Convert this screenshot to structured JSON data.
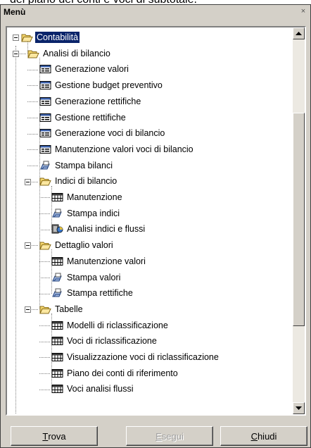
{
  "background_text": "del piano dei conti e voci di subtotale.",
  "window": {
    "title": "Menù",
    "close_glyph": "×"
  },
  "tree": {
    "items": [
      {
        "label": "Contabilità",
        "icon": "folder-open-icon",
        "level": 0,
        "expanded": true,
        "selected": true
      },
      {
        "label": "Analisi di bilancio",
        "icon": "folder-open-icon",
        "level": 1,
        "expanded": true
      },
      {
        "label": "Generazione valori",
        "icon": "form-icon",
        "level": 2
      },
      {
        "label": "Gestione budget preventivo",
        "icon": "form-icon",
        "level": 2
      },
      {
        "label": "Generazione rettifiche",
        "icon": "form-icon",
        "level": 2
      },
      {
        "label": "Gestione rettifiche",
        "icon": "form-icon",
        "level": 2
      },
      {
        "label": "Generazione voci di bilancio",
        "icon": "form-icon",
        "level": 2
      },
      {
        "label": "Manutenzione valori voci di bilancio",
        "icon": "form-icon",
        "level": 2
      },
      {
        "label": "Stampa bilanci",
        "icon": "print-icon",
        "level": 2
      },
      {
        "label": "Indici di bilancio",
        "icon": "folder-open-icon",
        "level": 2,
        "expanded": true
      },
      {
        "label": "Manutenzione",
        "icon": "grid-icon",
        "level": 3
      },
      {
        "label": "Stampa indici",
        "icon": "print-icon",
        "level": 3
      },
      {
        "label": "Analisi indici e flussi",
        "icon": "analysis-icon",
        "level": 3
      },
      {
        "label": "Dettaglio valori",
        "icon": "folder-open-icon",
        "level": 2,
        "expanded": true
      },
      {
        "label": "Manutenzione valori",
        "icon": "grid-icon",
        "level": 3
      },
      {
        "label": "Stampa valori",
        "icon": "print-icon",
        "level": 3
      },
      {
        "label": "Stampa rettifiche",
        "icon": "print-icon",
        "level": 3
      },
      {
        "label": "Tabelle",
        "icon": "folder-open-icon",
        "level": 2,
        "expanded": true
      },
      {
        "label": "Modelli di riclassificazione",
        "icon": "grid-icon",
        "level": 3
      },
      {
        "label": "Voci di riclassificazione",
        "icon": "grid-icon",
        "level": 3
      },
      {
        "label": "Visualizzazione voci di riclassificazione",
        "icon": "grid-icon",
        "level": 3
      },
      {
        "label": "Piano dei conti di riferimento",
        "icon": "grid-icon",
        "level": 3
      },
      {
        "label": "Voci analisi flussi",
        "icon": "grid-icon",
        "level": 3
      }
    ]
  },
  "buttons": {
    "find": {
      "mnemonic": "T",
      "rest": "rova"
    },
    "run": {
      "mnemonic": "E",
      "rest": "segui"
    },
    "close": {
      "mnemonic": "C",
      "rest": "hiudi"
    }
  },
  "colors": {
    "selection": "#0a246a",
    "folder": "#f5d76e",
    "form": "#3a5fa8",
    "window": "#d4d0c8"
  }
}
